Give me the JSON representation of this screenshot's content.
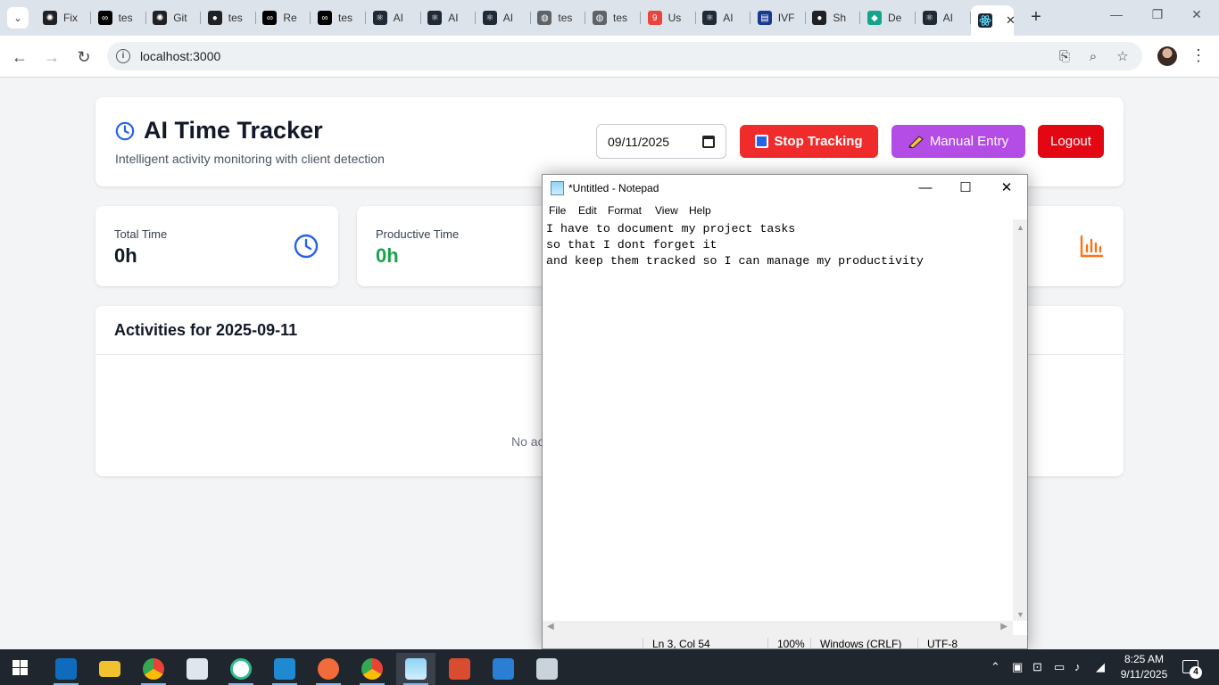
{
  "browser": {
    "tabs": [
      {
        "label": "Fix",
        "icon": "openai-icon",
        "color": "#202124"
      },
      {
        "label": "tes",
        "icon": "dev-icon",
        "color": "#000000"
      },
      {
        "label": "Git",
        "icon": "openai-icon",
        "color": "#202124"
      },
      {
        "label": "tes",
        "icon": "github-icon",
        "color": "#202124"
      },
      {
        "label": "Re",
        "icon": "dev-icon",
        "color": "#000000"
      },
      {
        "label": "tes",
        "icon": "dev-icon",
        "color": "#000000"
      },
      {
        "label": "AI",
        "icon": "react-icon",
        "color": "#1f2a36"
      },
      {
        "label": "AI",
        "icon": "react-icon",
        "color": "#1f2a36"
      },
      {
        "label": "AI",
        "icon": "react-icon",
        "color": "#1f2a36"
      },
      {
        "label": "tes",
        "icon": "globe-icon",
        "color": "#5f6368"
      },
      {
        "label": "tes",
        "icon": "globe-icon",
        "color": "#5f6368"
      },
      {
        "label": "Us",
        "icon": "badge-icon",
        "color": "#e8453c"
      },
      {
        "label": "AI",
        "icon": "react-icon",
        "color": "#1f2a36"
      },
      {
        "label": "IVF",
        "icon": "ivf-icon",
        "color": "#1a3a8f"
      },
      {
        "label": "Sh",
        "icon": "github-icon",
        "color": "#202124"
      },
      {
        "label": "De",
        "icon": "diamond-icon",
        "color": "#14a38b"
      },
      {
        "label": "AI",
        "icon": "react-icon",
        "color": "#1f2a36"
      }
    ],
    "url": "localhost:3000"
  },
  "app": {
    "title": "AI Time Tracker",
    "subtitle": "Intelligent activity monitoring with client detection",
    "date_value": "09/11/2025",
    "stop_label": "Stop Tracking",
    "manual_label": "Manual Entry",
    "logout_label": "Logout",
    "stats": [
      {
        "label": "Total Time",
        "value": "0h"
      },
      {
        "label": "Productive Time",
        "value": "0h"
      }
    ],
    "activities_title": "Activities for 2025-09-11",
    "empty_text": "No ac"
  },
  "notepad": {
    "title": "*Untitled - Notepad",
    "menus": [
      "File",
      "Edit",
      "Format",
      "View",
      "Help"
    ],
    "content": "I have to document my project tasks\nso that I dont forget it\nand keep them tracked so I can manage my productivity",
    "status": {
      "position": "Ln 3, Col 54",
      "zoom": "100%",
      "line_ending": "Windows (CRLF)",
      "encoding": "UTF-8"
    }
  },
  "taskbar": {
    "time": "8:25 AM",
    "date": "9/11/2025",
    "notification_count": "4"
  },
  "colors": {
    "stop": "#ef2b2b",
    "manual": "#b44ce6",
    "logout": "#e30613",
    "accent_blue": "#2563eb",
    "green": "#16a34a",
    "orange": "#f97316"
  }
}
